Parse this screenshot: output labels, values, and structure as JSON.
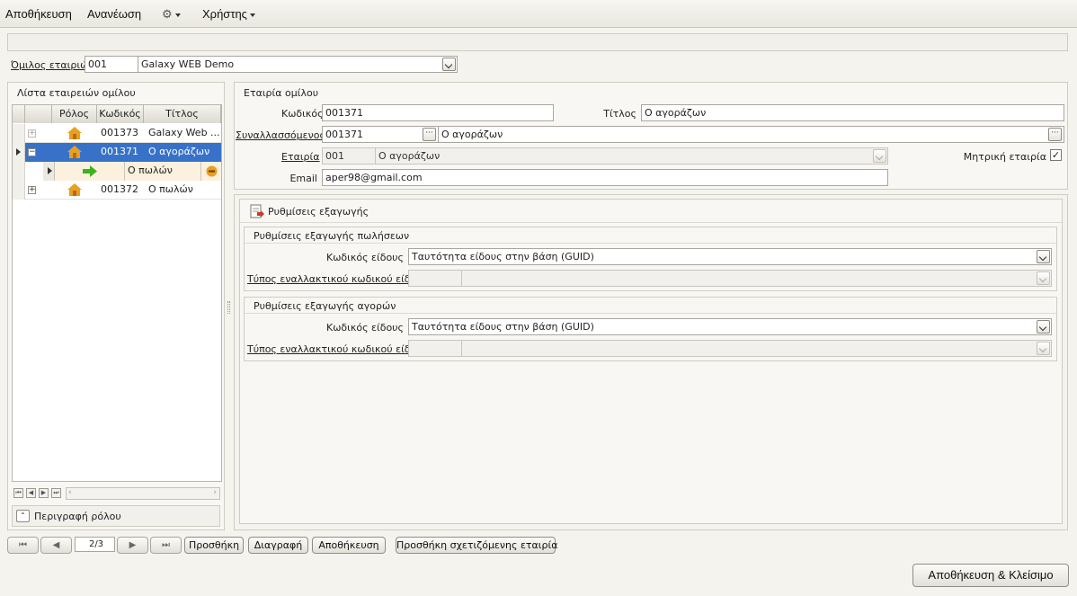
{
  "menu": {
    "save": "Αποθήκευση",
    "refresh": "Ανανέωση",
    "users": "Χρήστης"
  },
  "group": {
    "label": "Όμιλος εταιριών",
    "code": "001",
    "name": "Galaxy WEB Demo"
  },
  "list_panel": {
    "title": "Λίστα εταιρειών ομίλου",
    "columns": [
      "Ρόλος",
      "Κωδικός",
      "Τίτλος"
    ],
    "rows": [
      {
        "code": "001373",
        "title": "Galaxy Web ..."
      },
      {
        "code": "001371",
        "title": "Ο αγοράζων"
      },
      {
        "child_title": "Ο πωλών"
      },
      {
        "code": "001372",
        "title": "Ο πωλών"
      }
    ],
    "role_description": "Περιγραφή ρόλου"
  },
  "company": {
    "title": "Εταιρία ομίλου",
    "code_label": "Κωδικός",
    "code_value": "001371",
    "title_label": "Τίτλος",
    "title_value": "Ο αγοράζων",
    "partner_label": "Συναλλασσόμενος",
    "partner_code": "001371",
    "partner_name": "Ο αγοράζων",
    "company_label": "Εταιρία",
    "company_code": "001",
    "company_name": "Ο αγοράζων",
    "parent_label": "Μητρική εταιρία",
    "email_label": "Email",
    "email_value": "aper98@gmail.com"
  },
  "export": {
    "title": "Ρυθμίσεις εξαγωγής",
    "sales": {
      "title": "Ρυθμίσεις εξαγωγής πωλήσεων",
      "item_code_label": "Κωδικός είδους",
      "item_code_value": "Ταυτότητα είδους στην βάση (GUID)",
      "alt_code_label": "Τύπος εναλλακτικού κωδικού είδους"
    },
    "purchases": {
      "title": "Ρυθμίσεις εξαγωγής αγορών",
      "item_code_label": "Κωδικός είδους",
      "item_code_value": "Ταυτότητα είδους στην βάση (GUID)",
      "alt_code_label": "Τύπος εναλλακτικού κωδικού είδους"
    }
  },
  "pager": {
    "position": "2/3",
    "add": "Προσθήκη",
    "delete": "Διαγραφή",
    "save": "Αποθήκευση",
    "add_related": "Προσθήκη σχετιζόμενης εταιρία"
  },
  "footer": {
    "save_close": "Αποθήκευση & Κλείσιμο"
  },
  "colors": {
    "selected_row": "#3872c8",
    "child_row": "#fbf1de",
    "accent_orange": "#e8a020",
    "arrow_green": "#3db31e"
  },
  "icons": [
    "settings-gear-icon",
    "house-icon",
    "green-arrow-icon",
    "minus-circle-icon",
    "export-settings-icon",
    "grid-first-icon",
    "grid-prev-icon",
    "grid-next-icon",
    "grid-last-icon"
  ]
}
